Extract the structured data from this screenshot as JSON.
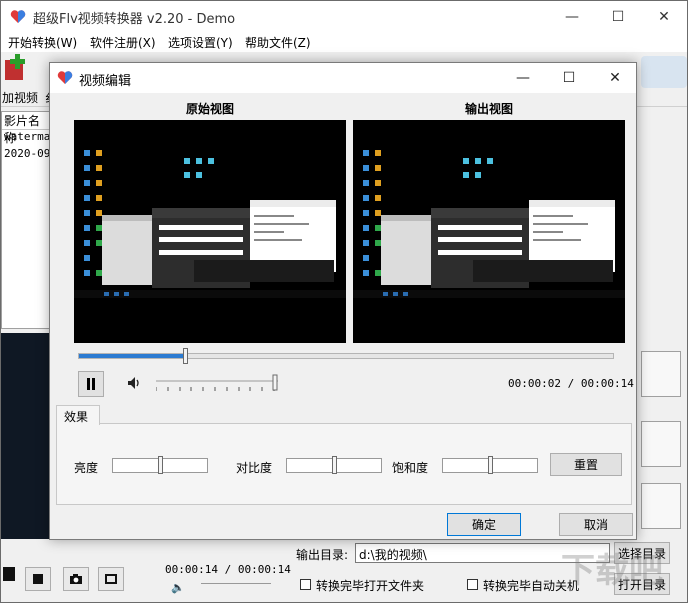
{
  "main": {
    "title": "超级Flv视频转换器 v2.20 - Demo",
    "menu": [
      "开始转换(W)",
      "软件注册(X)",
      "选项设置(Y)",
      "帮助文件(Z)"
    ],
    "toolbar_add_label": "加视频",
    "toolbar_add_extra": "纟",
    "list_header": "影片名称",
    "list_rows": [
      "waterma",
      "2020-09"
    ],
    "bottom": {
      "time": "00:00:14 / 00:00:14",
      "output_label": "输出目录:",
      "output_value": "d:\\我的视频\\",
      "choose_button": "选择目录",
      "open_button": "打开目录",
      "checkbox_open": "转换完毕打开文件夹",
      "checkbox_shutdown": "转换完毕自动关机"
    },
    "watermark": "下载吧"
  },
  "dialog": {
    "title": "视频编辑",
    "original_label": "原始视图",
    "output_label": "输出视图",
    "time_current": "00:00:02",
    "time_sep": " / ",
    "time_total": "00:00:14",
    "seek_progress": 0.2,
    "volume_level": 0.99,
    "effects_tab": "效果",
    "brightness_label": "亮度",
    "brightness_level": 0.5,
    "contrast_label": "对比度",
    "contrast_level": 0.5,
    "saturation_label": "饱和度",
    "saturation_level": 0.5,
    "reset_button": "重置",
    "ok_button": "确定",
    "cancel_button": "取消"
  },
  "colors": {
    "accent": "#2c7bd1",
    "preview_bg": "#000000"
  }
}
